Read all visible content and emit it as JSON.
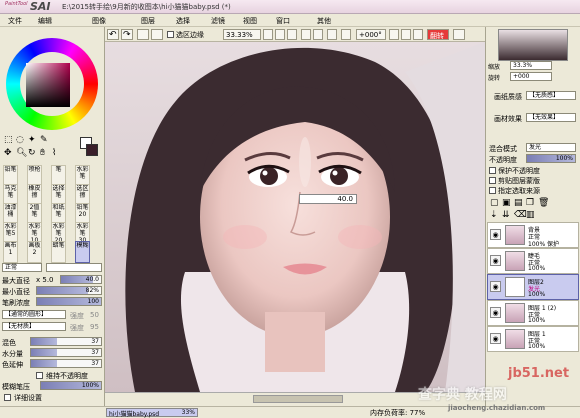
{
  "app": {
    "logo_small": "PaintTool",
    "logo_big": "SAI",
    "title": "E:\\2015转手绘\\9月新的收图本\\hi小猫猫baby.psd (*)"
  },
  "menu": [
    "文件",
    "编辑",
    "图像",
    "图层",
    "选择",
    "滤镜",
    "视图",
    "窗口",
    "其他"
  ],
  "toolbar": {
    "selection_edge_label": "选区边缘",
    "zoom": "33.33%",
    "rotation": "+000°",
    "flip_label": "翻转"
  },
  "tools": {
    "top_icons": [
      "move-icon",
      "zoom-icon",
      "rotate-icon",
      "hand-icon",
      "eyedropper-icon"
    ]
  },
  "brushes": [
    [
      "铅笔",
      "喷枪",
      "笔",
      "水彩笔"
    ],
    [
      "马克笔",
      "橡皮擦",
      "选择笔",
      "选区擦"
    ],
    [
      "油漆桶",
      "2值笔",
      "和纸笔",
      "铅笔20"
    ],
    [
      "水彩笔5",
      "水彩笔10",
      "水彩笔20",
      "水彩笔30"
    ],
    [
      "画布1",
      "画板2",
      "蜡笔",
      "模糊"
    ]
  ],
  "brush_settings": {
    "mode": "正常",
    "max_diameter_label": "最大直径",
    "max_diameter_mult": "x 5.0",
    "max_diameter": "40.0",
    "min_diameter_label": "最小直径",
    "min_diameter": "82%",
    "density_label": "笔刷浓度",
    "density": "100",
    "shape_value": "【通常的圆形】",
    "shape_strength": "强度",
    "shape_strength_val": "50",
    "texture_value": "【无材质】",
    "texture_strength": "强度",
    "texture_strength_val": "95",
    "blend_label": "混色",
    "blend": "37",
    "water_label": "水分量",
    "water": "37",
    "persist_label": "色延伸",
    "persist": "37",
    "keep_opacity_label": "维持不透明度",
    "blur_pressure_label": "模糊笔压",
    "blur_pressure": "100%",
    "detail_label": "详细设置"
  },
  "canvas": {
    "brush_size_overlay": "40.0",
    "file_tab": "hi小猫猫baby.psd",
    "file_zoom": "33%"
  },
  "navigator": {
    "zoom_label": "缩放",
    "zoom": "33.3%",
    "angle_label": "旋转",
    "angle": "+000"
  },
  "layer_props": {
    "texture_label": "画纸质感",
    "texture": "【无质感】",
    "effect_label": "画材效果",
    "effect": "【无效果】",
    "blend_mode_label": "混合模式",
    "blend_mode": "发光",
    "opacity_label": "不透明度",
    "opacity": "100%",
    "protect_label": "保护不透明度",
    "clip_label": "剪贴图层蒙版",
    "source_label": "指定选取来源"
  },
  "layers": [
    {
      "name": "背景",
      "mode": "正常",
      "opacity": "100% 保护"
    },
    {
      "name": "睫毛",
      "mode": "正常",
      "opacity": "100%"
    },
    {
      "name": "图层2",
      "mode": "发光",
      "opacity": "100%"
    },
    {
      "name": "图层 1 (2)",
      "mode": "正常",
      "opacity": "100%"
    },
    {
      "name": "图层 1",
      "mode": "正常",
      "opacity": "100%"
    }
  ],
  "status": {
    "memory": "内存负荷率: 77%",
    "watermark1": "jb51.net",
    "watermark2": "查字典 教程网",
    "watermark3": "jiaocheng.chazidian.com"
  },
  "colors": {
    "accent": "#7b7fb5",
    "layer_selected": "#c9cbef",
    "primary": "#b0004c"
  }
}
